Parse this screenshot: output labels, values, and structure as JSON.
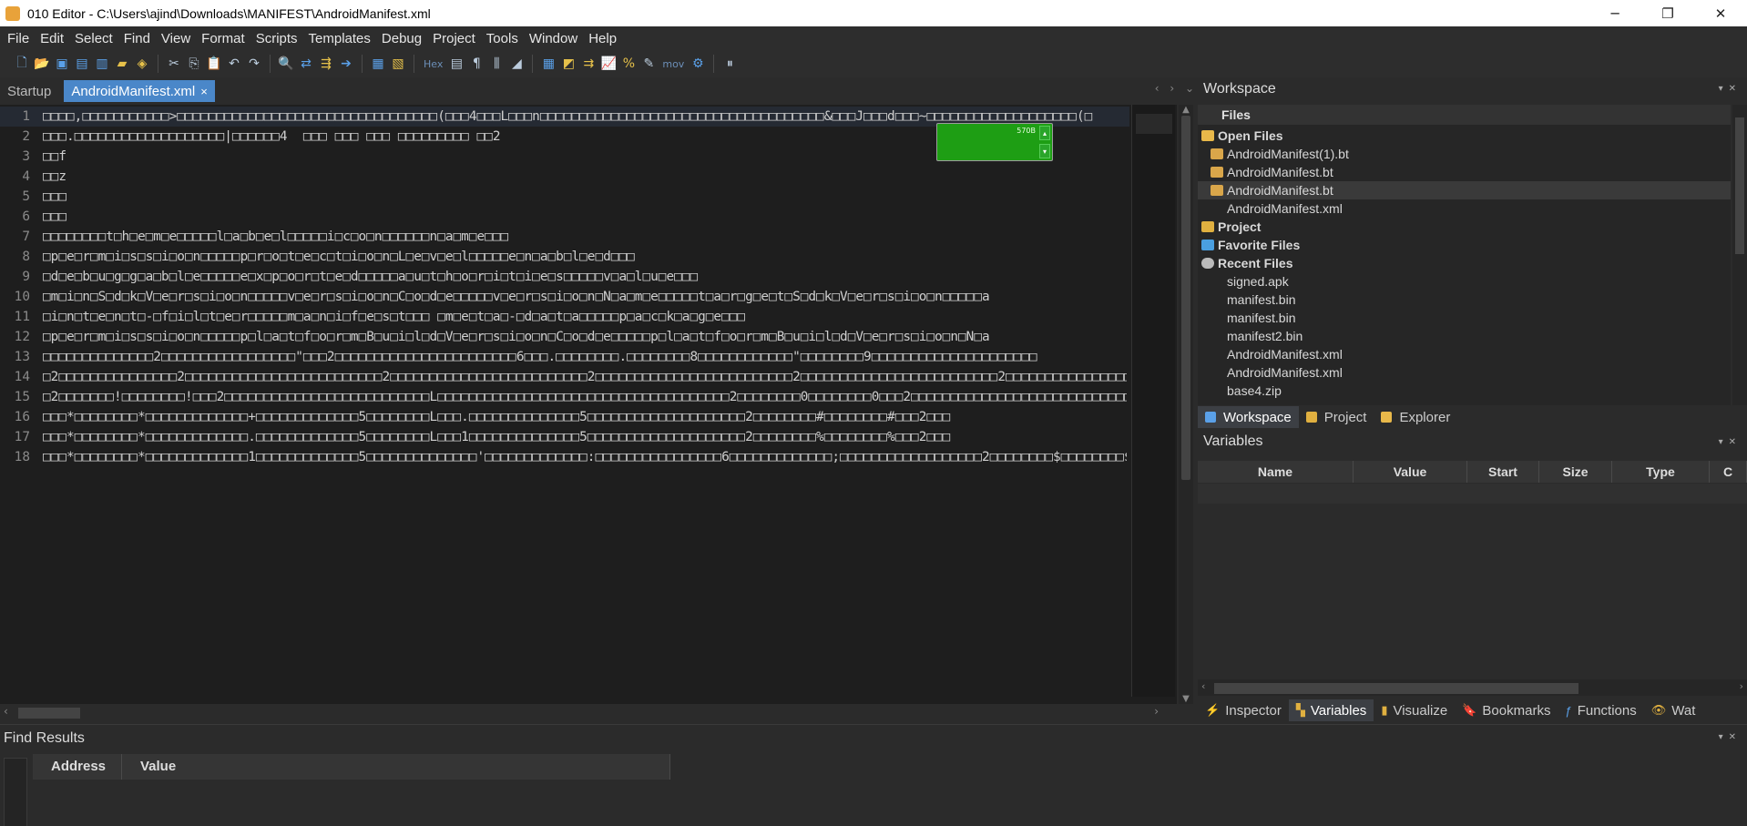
{
  "window": {
    "title": "010 Editor - C:\\Users\\ajind\\Downloads\\MANIFEST\\AndroidManifest.xml",
    "minimize": "─",
    "restore": "❐",
    "close": "✕"
  },
  "menu": [
    "File",
    "Edit",
    "Select",
    "Find",
    "View",
    "Format",
    "Scripts",
    "Templates",
    "Debug",
    "Project",
    "Tools",
    "Window",
    "Help"
  ],
  "toolbar": {
    "hex_label": "Hex",
    "mov_label": "mov"
  },
  "editor_tabs": {
    "startup": "Startup",
    "active": "AndroidManifest.xml",
    "close": "×",
    "nav": "‹ › ⌄"
  },
  "editor": {
    "lines": [
      {
        "n": "1",
        "text": "□□□□,□□□□□□□□□□□>□□□□□□□□□□□□□□□□□□□□□□□□□□□□□□□□□(□□□4□□□L□□□n□□□□□□□□□□□□□□□□□□□□□□□□□□□□□□□□□□□□&□□□J□□□d□□□~□□□□□□□□□□□□□□□□□□□(□"
      },
      {
        "n": "2",
        "text": "□□□.□□□□□□□□□□□□□□□□□□□|□□□□□□4  □□□ □□□ □□□ □□□□□□□□□ □□2"
      },
      {
        "n": "3",
        "text": "□□f"
      },
      {
        "n": "4",
        "text": "□□z"
      },
      {
        "n": "5",
        "text": "□□□"
      },
      {
        "n": "6",
        "text": "□□□"
      },
      {
        "n": "7",
        "text": "□□□□□□□□t□h□e□m□e□□□□□l□a□b□e□l□□□□□i□c□o□n□□□□□□n□a□m□e□□□"
      },
      {
        "n": "8",
        "text": "□p□e□r□m□i□s□s□i□o□n□□□□□p□r□o□t□e□c□t□i□o□n□L□e□v□e□l□□□□□e□n□a□b□l□e□d□□□"
      },
      {
        "n": "9",
        "text": "□d□e□b□u□g□g□a□b□l□e□□□□□e□x□p□o□r□t□e□d□□□□□a□u□t□h□o□r□i□t□i□e□s□□□□□v□a□l□u□e□□□"
      },
      {
        "n": "10",
        "text": "□m□i□n□S□d□k□V□e□r□s□i□o□n□□□□□v□e□r□s□i□o□n□C□o□d□e□□□□□v□e□r□s□i□o□n□N□a□m□e□□□□□t□a□r□g□e□t□S□d□k□V□e□r□s□i□o□n□□□□□a"
      },
      {
        "n": "11",
        "text": "□i□n□t□e□n□t□-□f□i□l□t□e□r□□□□□m□a□n□i□f□e□s□t□□□ □m□e□t□a□-□d□a□t□a□□□□□p□a□c□k□a□g□e□□□"
      },
      {
        "n": "12",
        "text": "□p□e□r□m□i□s□s□i□o□n□□□□□p□l□a□t□f□o□r□m□B□u□i□l□d□V□e□r□s□i□o□n□C□o□d□e□□□□□p□l□a□t□f□o□r□m□B□u□i□l□d□V□e□r□s□i□o□n□N□a"
      },
      {
        "n": "13",
        "text": "□□□□□□□□□□□□□□2□□□□□□□□□□□□□□□□□\"□□□2□□□□□□□□□□□□□□□□□□□□□□□6□□□.□□□□□□□□.□□□□□□□□8□□□□□□□□□□□□\"□□□□□□□□9□□□□□□□□□□□□□□□□□□□□□"
      },
      {
        "n": "14",
        "text": "□2□□□□□□□□□□□□□□□2□□□□□□□□□□□□□□□□□□□□□□□□□2□□□□□□□□□□□□□□□□□□□□□□□□□2□□□□□□□□□□□□□□□□□□□□□□□□□2□□□□□□□□□□□□□□□□□□□□□□□□□2□□□□□□□□□□□□□□□□□□□□"
      },
      {
        "n": "15",
        "text": "□2□□□□□□□!□□□□□□□□!□□□2□□□□□□□□□□□□□□□□□□□□□□□□□□L□□□□□□□□□□□□□□□□□□□□□□□□□□□□□□□□□□□□□2□□□□□□□□0□□□□□□□□0□□□2□□□□□□□□□□□□□□□□□□□□□□□□□□□□□"
      },
      {
        "n": "16",
        "text": "□□□*□□□□□□□□*□□□□□□□□□□□□□+□□□□□□□□□□□□□5□□□□□□□□L□□□.□□□□□□□□□□□□□□5□□□□□□□□□□□□□□□□□□□□2□□□□□□□□#□□□□□□□□#□□□2□□□"
      },
      {
        "n": "17",
        "text": "□□□*□□□□□□□□*□□□□□□□□□□□□□.□□□□□□□□□□□□□5□□□□□□□□L□□□1□□□□□□□□□□□□□□5□□□□□□□□□□□□□□□□□□□□2□□□□□□□□%□□□□□□□□%□□□2□□□"
      },
      {
        "n": "18",
        "text": "□□□*□□□□□□□□*□□□□□□□□□□□□□1□□□□□□□□□□□□□5□□□□□□□□□□□□□□'□□□□□□□□□□□□□:□□□□□□□□□□□□□□□□6□□□□□□□□□□□□□;□□□□□□□□□□□□□□□□□□2□□□□□□□□$□□□□□□□□$□□□2"
      }
    ]
  },
  "widget": {
    "label": "570B"
  },
  "workspace": {
    "title": "Workspace",
    "files_header": "Files",
    "tree": [
      {
        "label": "Open Files",
        "group": true,
        "icon": "folder-open-icon"
      },
      {
        "label": "AndroidManifest(1).bt",
        "group": false,
        "icon": "template-file-icon"
      },
      {
        "label": "AndroidManifest.bt",
        "group": false,
        "icon": "template-file-icon"
      },
      {
        "label": "AndroidManifest.bt",
        "group": false,
        "icon": "template-file-icon",
        "selected": true
      },
      {
        "label": "AndroidManifest.xml",
        "group": false,
        "icon": "none"
      },
      {
        "label": "Project",
        "group": true,
        "icon": "project-folder-icon"
      },
      {
        "label": "Favorite Files",
        "group": true,
        "icon": "favorite-icon"
      },
      {
        "label": "Recent Files",
        "group": true,
        "icon": "recent-icon"
      },
      {
        "label": "signed.apk",
        "group": false,
        "icon": "none"
      },
      {
        "label": "manifest.bin",
        "group": false,
        "icon": "none"
      },
      {
        "label": "manifest.bin",
        "group": false,
        "icon": "none"
      },
      {
        "label": "manifest2.bin",
        "group": false,
        "icon": "none"
      },
      {
        "label": "AndroidManifest.xml",
        "group": false,
        "icon": "none"
      },
      {
        "label": "AndroidManifest.xml",
        "group": false,
        "icon": "none"
      },
      {
        "label": "base4.zip",
        "group": false,
        "icon": "none"
      }
    ],
    "tabs": [
      "Workspace",
      "Project",
      "Explorer"
    ]
  },
  "variables": {
    "title": "Variables",
    "columns": [
      "Name",
      "Value",
      "Start",
      "Size",
      "Type",
      "C"
    ]
  },
  "bottom_tabs": [
    "Inspector",
    "Variables",
    "Visualize",
    "Bookmarks",
    "Functions",
    "Wat"
  ],
  "find_results": {
    "title": "Find Results",
    "columns": [
      "Address",
      "Value"
    ]
  }
}
